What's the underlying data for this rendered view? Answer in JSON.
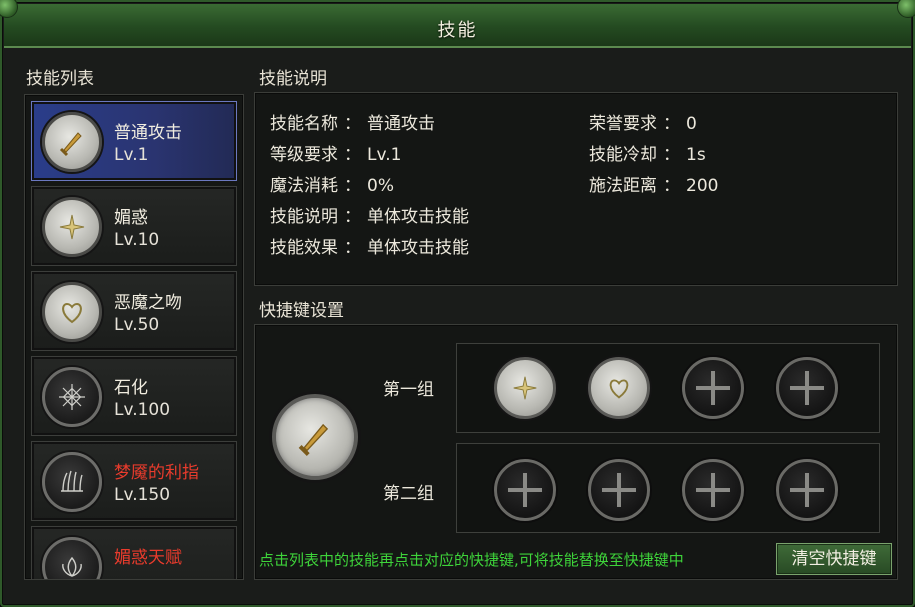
{
  "window": {
    "title": "技能"
  },
  "skill_list": {
    "title": "技能列表",
    "items": [
      {
        "name": "普通攻击",
        "level": "Lv.1",
        "icon": "sword-icon",
        "selected": true
      },
      {
        "name": "媚惑",
        "level": "Lv.10",
        "icon": "sparkle-icon"
      },
      {
        "name": "恶魔之吻",
        "level": "Lv.50",
        "icon": "heart-icon"
      },
      {
        "name": "石化",
        "level": "Lv.100",
        "icon": "web-icon"
      },
      {
        "name": "梦魇的利指",
        "level": "Lv.150",
        "icon": "claw-icon",
        "locked_red": true
      },
      {
        "name": "媚惑天赋",
        "level": "",
        "icon": "lotus-icon",
        "locked_red": true
      }
    ]
  },
  "description": {
    "title": "技能说明",
    "sep": "：",
    "left": [
      {
        "label": "技能名称",
        "value": "普通攻击"
      },
      {
        "label": "等级要求",
        "value": "Lv.1"
      },
      {
        "label": "魔法消耗",
        "value": "0%"
      },
      {
        "label": "技能说明",
        "value": "单体攻击技能"
      },
      {
        "label": "技能效果",
        "value": "单体攻击技能"
      }
    ],
    "right": [
      {
        "label": "荣誉要求",
        "value": "0"
      },
      {
        "label": "技能冷却",
        "value": "1s"
      },
      {
        "label": "施法距离",
        "value": "200"
      }
    ]
  },
  "hotkeys": {
    "title": "快捷键设置",
    "selected_skill_icon": "sword-icon",
    "groups": [
      {
        "label": "第一组",
        "slots": [
          "sparkle-icon",
          "heart-icon",
          "empty",
          "empty"
        ]
      },
      {
        "label": "第二组",
        "slots": [
          "empty",
          "empty",
          "empty",
          "empty"
        ]
      }
    ],
    "hint": "点击列表中的技能再点击对应的快捷键,可将技能替换至快捷键中",
    "clear_button": "清空快捷键"
  },
  "colors": {
    "accent_green": "#3ed33a",
    "locked_red": "#e83b2c",
    "selected_blue": "#2a3d8a"
  }
}
